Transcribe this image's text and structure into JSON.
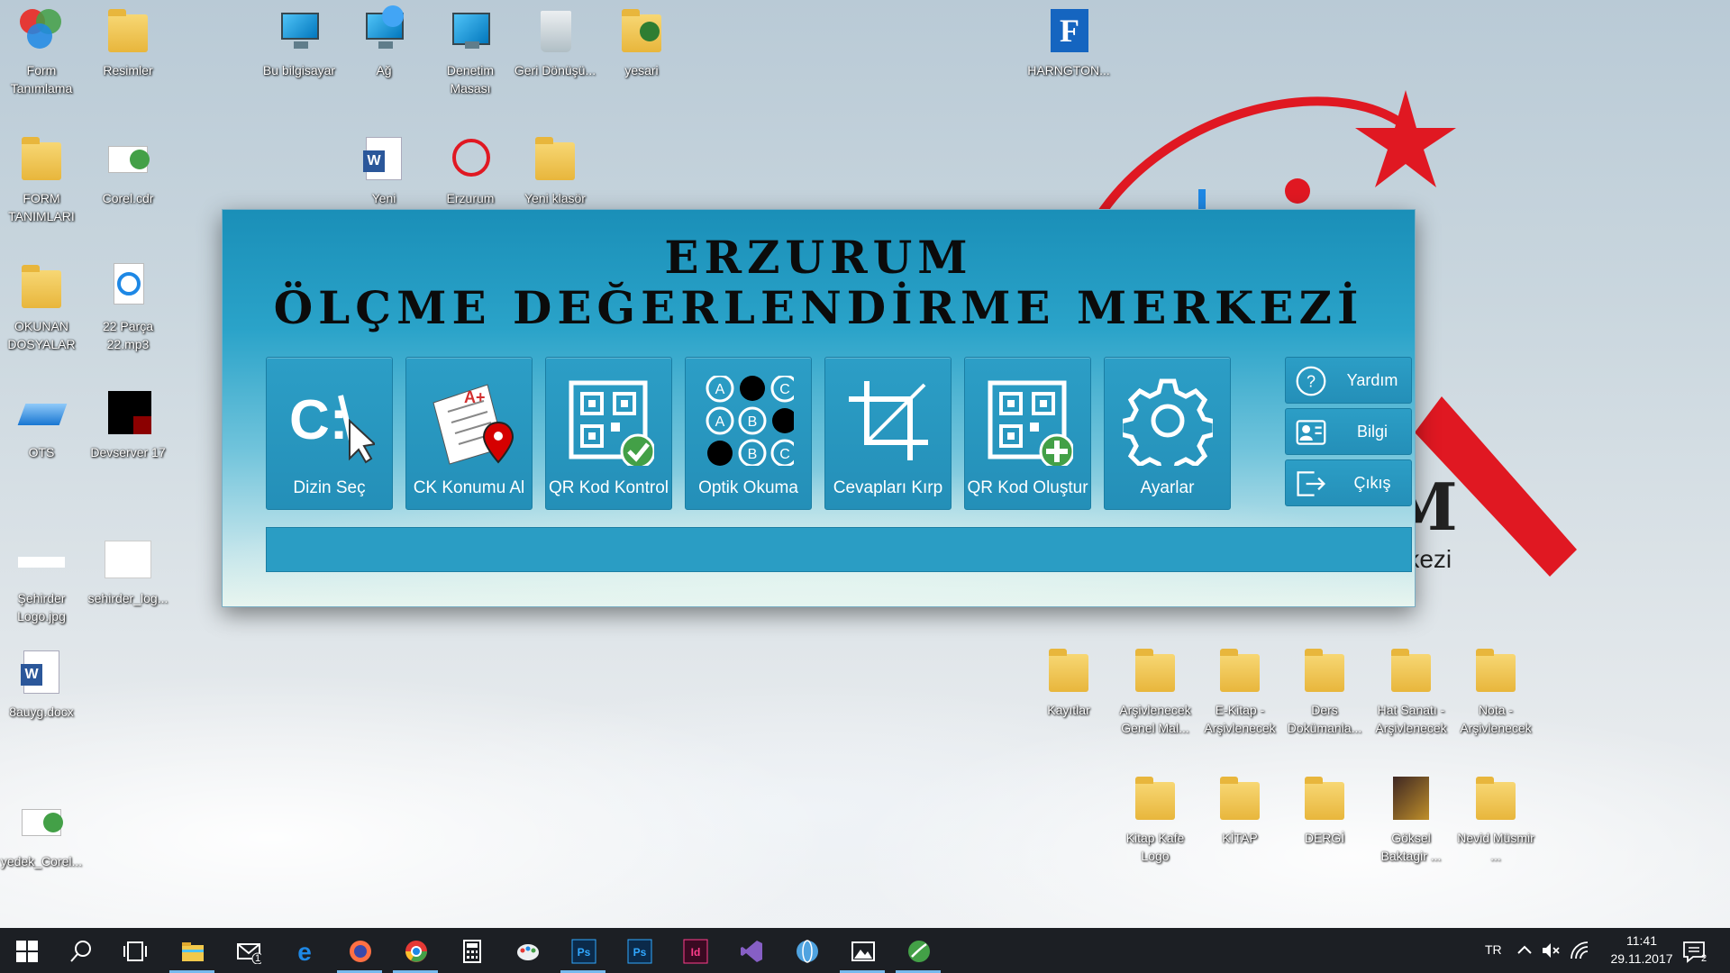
{
  "desktop": {
    "icons": [
      {
        "label": "Form Tanımlama",
        "icon": "form-app-icon"
      },
      {
        "label": "Resimler",
        "icon": "folder-icon"
      },
      {
        "label": "Bu bilgisayar",
        "icon": "computer-icon"
      },
      {
        "label": "Ağ",
        "icon": "network-icon"
      },
      {
        "label": "Denetim Masası",
        "icon": "control-panel-icon"
      },
      {
        "label": "Geri Dönüşü...",
        "icon": "recycle-bin-icon"
      },
      {
        "label": "yesari",
        "icon": "user-folder-icon"
      },
      {
        "label": "HARNGTON...",
        "icon": "font-app-icon"
      },
      {
        "label": "FORM TANIMLARI",
        "icon": "folder-icon"
      },
      {
        "label": "Corel.cdr",
        "icon": "corel-file-icon"
      },
      {
        "label": "Yeni",
        "icon": "word-doc-icon"
      },
      {
        "label": "Erzurum",
        "icon": "erzurum-logo-icon"
      },
      {
        "label": "Yeni klasör",
        "icon": "folder-icon"
      },
      {
        "label": "OKUNAN DOSYALAR",
        "icon": "folder-icon"
      },
      {
        "label": "22 Parça 22.mp3",
        "icon": "audio-file-icon"
      },
      {
        "label": "OTS",
        "icon": "scanner-icon"
      },
      {
        "label": "Devserver 17",
        "icon": "devserver-icon"
      },
      {
        "label": "Şehirder Logo.jpg",
        "icon": "image-file-icon"
      },
      {
        "label": "sehirder_log...",
        "icon": "image-file-icon"
      },
      {
        "label": "8auyg.docx",
        "icon": "word-doc-icon"
      },
      {
        "label": "yedek_Corel...",
        "icon": "corel-file-icon"
      },
      {
        "label": "Kayıtlar",
        "icon": "folder-icon"
      },
      {
        "label": "Arşivlenecek Genel Mal...",
        "icon": "folder-icon"
      },
      {
        "label": "E-Kitap - Arşivlenecek",
        "icon": "folder-icon"
      },
      {
        "label": "Ders Dokümanla...",
        "icon": "folder-icon"
      },
      {
        "label": "Hat Sanatı - Arşivlenecek",
        "icon": "folder-icon"
      },
      {
        "label": "Nota - Arşivlenecek",
        "icon": "folder-icon"
      },
      {
        "label": "Kitap Kafe Logo",
        "icon": "folder-icon"
      },
      {
        "label": "KİTAP",
        "icon": "folder-icon"
      },
      {
        "label": "DERGİ",
        "icon": "folder-icon"
      },
      {
        "label": "Göksel Baktagir ...",
        "icon": "album-folder-icon"
      },
      {
        "label": "Nevid Müsmir ...",
        "icon": "folder-icon"
      }
    ],
    "wallpaper_logo": {
      "letter": "M",
      "word": "rkezi"
    }
  },
  "app": {
    "title_line1": "ERZURUM",
    "title_line2": "ÖLÇME DEĞERLENDİRME MERKEZİ",
    "tiles": [
      {
        "label": "Dizin Seç",
        "icon": "directory-cursor-icon"
      },
      {
        "label": "CK Konumu Al",
        "icon": "answer-sheet-location-icon"
      },
      {
        "label": "QR Kod Kontrol",
        "icon": "qr-check-icon"
      },
      {
        "label": "Optik Okuma",
        "icon": "optical-bubbles-icon"
      },
      {
        "label": "Cevapları Kırp",
        "icon": "crop-icon"
      },
      {
        "label": "QR Kod Oluştur",
        "icon": "qr-add-icon"
      },
      {
        "label": "Ayarlar",
        "icon": "gear-icon"
      }
    ],
    "side_buttons": [
      {
        "label": "Yardım",
        "icon": "help-icon"
      },
      {
        "label": "Bilgi",
        "icon": "info-card-icon"
      },
      {
        "label": "Çıkış",
        "icon": "exit-icon"
      }
    ],
    "status_text": ""
  },
  "taskbar": {
    "apps": [
      "start",
      "search",
      "task-view",
      "file-explorer",
      "mail",
      "edge",
      "firefox",
      "chrome",
      "calculator",
      "paint",
      "photoshop",
      "photoshop-2",
      "indesign",
      "visual-studio",
      "network-tool",
      "photos",
      "corel"
    ],
    "mail_badge": "1",
    "language": "TR",
    "time": "11:41",
    "date": "29.11.2017",
    "notification_count": "2"
  },
  "colors": {
    "tile_bg": "#2a9dc4",
    "tile_border": "#1b7ea3",
    "taskbar_bg": "#1c1f24",
    "accent": "#76b9ed"
  }
}
